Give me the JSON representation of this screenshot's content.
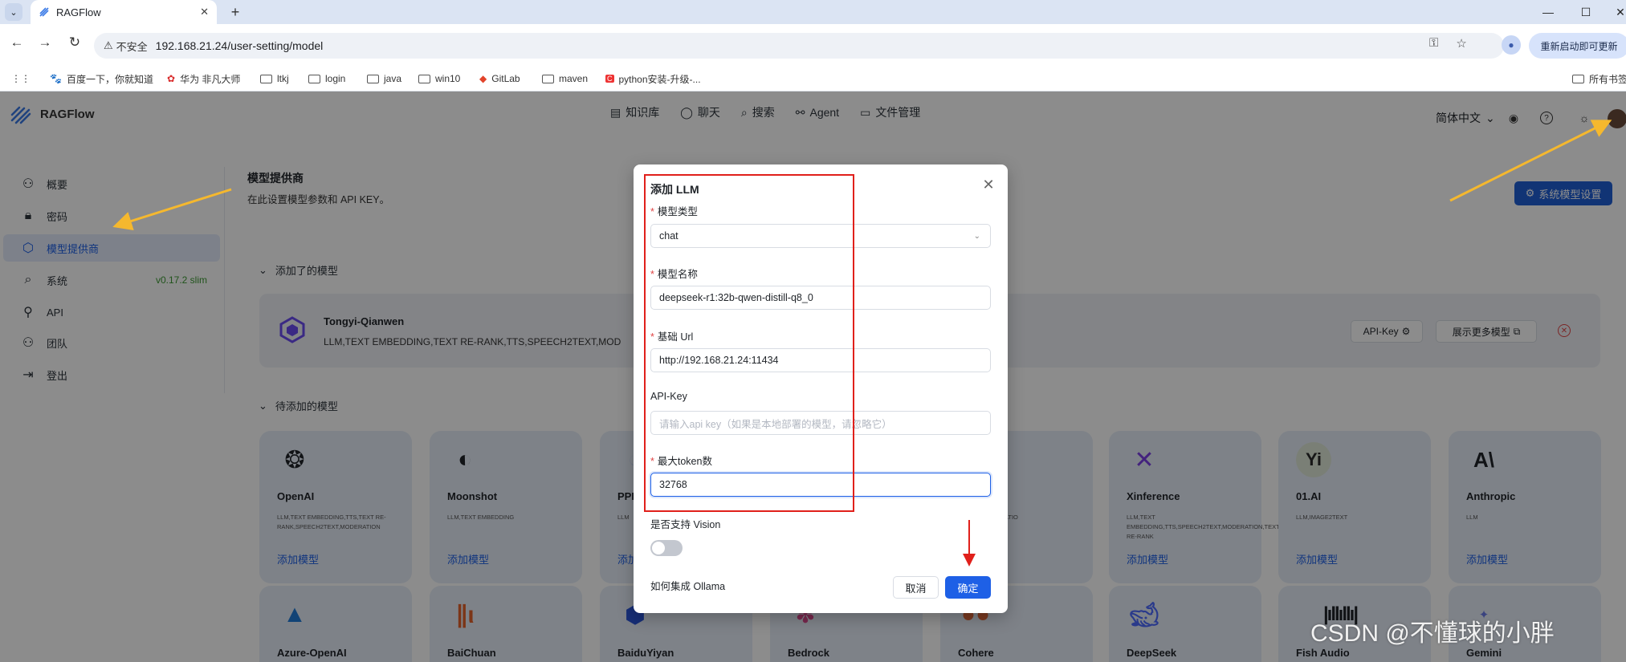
{
  "browser": {
    "tab_title": "RAGFlow",
    "insecure_label": "不安全",
    "url": "192.168.21.24/user-setting/model",
    "restart_label": "重新启动即可更新",
    "bookmarks": [
      "百度一下，你就知道",
      "华为 非凡大师",
      "ltkj",
      "login",
      "java",
      "win10",
      "GitLab",
      "maven",
      "python安装-升级-...",
      "所有书签"
    ]
  },
  "header": {
    "app_name": "RAGFlow",
    "nav": [
      "知识库",
      "聊天",
      "搜索",
      "Agent",
      "文件管理"
    ],
    "language": "简体中文"
  },
  "sidebar": {
    "items": [
      "概要",
      "密码",
      "模型提供商",
      "系统",
      "API",
      "团队",
      "登出"
    ],
    "version": "v0.17.2 slim"
  },
  "main": {
    "title": "模型提供商",
    "description": "在此设置模型参数和 API KEY。",
    "system_model_button": "系统模型设置",
    "added_section": "添加了的模型",
    "pending_section": "待添加的模型",
    "added_model": {
      "name": "Tongyi-Qianwen",
      "tags": "LLM,TEXT EMBEDDING,TEXT RE-RANK,TTS,SPEECH2TEXT,MOD",
      "api_key_button": "API-Key",
      "show_more_button": "展示更多模型"
    },
    "add_model_link": "添加模型",
    "providers_row1": [
      {
        "name": "OpenAI",
        "tags": "LLM,TEXT EMBEDDING,TTS,TEXT RE-RANK,SPEECH2TEXT,MODERATION"
      },
      {
        "name": "Moonshot",
        "tags": "LLM,TEXT EMBEDDING"
      },
      {
        "name": "PPI",
        "tags": "LLM"
      },
      {
        "name": "",
        "tags": ""
      },
      {
        "name": "",
        "tags": "H2TEXT,MODERATIO"
      },
      {
        "name": "Xinference",
        "tags": "LLM,TEXT EMBEDDING,TTS,SPEECH2TEXT,MODERATION,TEXT RE-RANK"
      },
      {
        "name": "01.AI",
        "tags": "LLM,IMAGE2TEXT"
      },
      {
        "name": "Anthropic",
        "tags": "LLM"
      }
    ],
    "providers_row2": [
      "Azure-OpenAI",
      "BaiChuan",
      "BaiduYiyan",
      "Bedrock",
      "Cohere",
      "DeepSeek",
      "Fish Audio",
      "Gemini"
    ]
  },
  "modal": {
    "title": "添加 LLM",
    "model_type_label": "模型类型",
    "model_type_value": "chat",
    "model_name_label": "模型名称",
    "model_name_value": "deepseek-r1:32b-qwen-distill-q8_0",
    "base_url_label": "基础 Url",
    "base_url_value": "http://192.168.21.24:11434",
    "api_key_label": "API-Key",
    "api_key_placeholder": "请输入api key（如果是本地部署的模型，请忽略它）",
    "max_token_label": "最大token数",
    "max_token_value": "32768",
    "vision_label": "是否支持 Vision",
    "vision_enabled": false,
    "ollama_link": "如何集成 Ollama",
    "cancel": "取消",
    "ok": "确定"
  },
  "watermark": "CSDN @不懂球的小胖",
  "colors": {
    "accent": "#1e60e6",
    "annotation_red": "#e0201b",
    "annotation_arrow": "#f5b82e"
  }
}
